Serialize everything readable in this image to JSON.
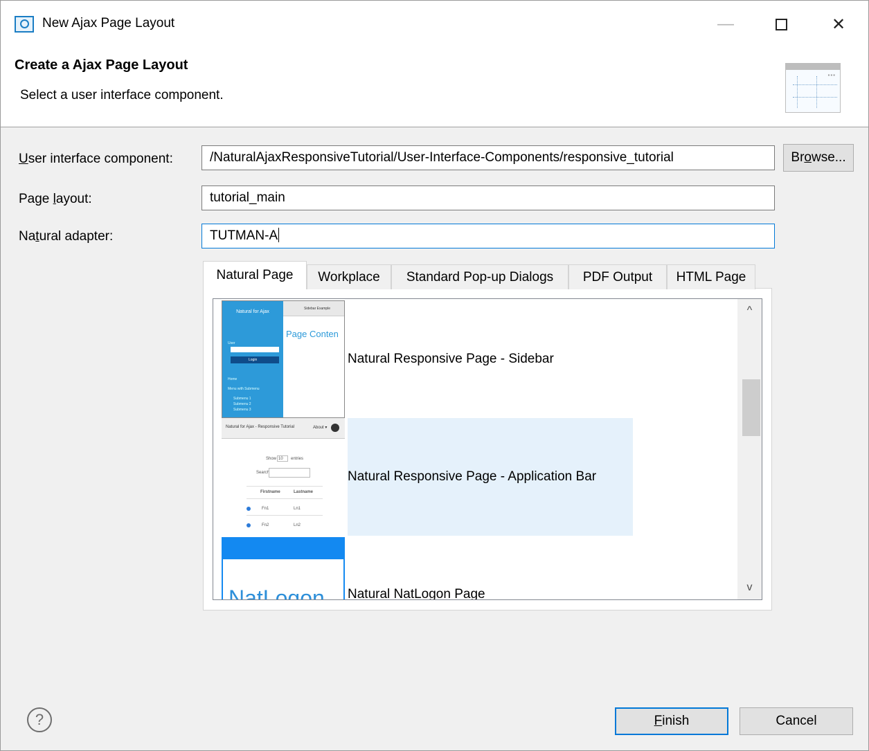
{
  "window": {
    "title": "New Ajax Page Layout",
    "minimize_glyph": "—",
    "close_glyph": "✕"
  },
  "banner": {
    "title": "Create a Ajax Page Layout",
    "description": "Select a user interface component."
  },
  "form": {
    "ui_component": {
      "label_prefix": "",
      "label_mnemonic": "U",
      "label_rest": "ser interface component:",
      "value": "/NaturalAjaxResponsiveTutorial/User-Interface-Components/responsive_tutorial"
    },
    "browse_button": {
      "label_prefix": "Br",
      "label_mnemonic": "o",
      "label_rest": "wse..."
    },
    "page_layout": {
      "label_prefix": "Page ",
      "label_mnemonic": "l",
      "label_rest": "ayout:",
      "value": "tutorial_main"
    },
    "natural_adapter": {
      "label_prefix": "Na",
      "label_mnemonic": "t",
      "label_rest": "ural adapter:",
      "value": "TUTMAN-A"
    }
  },
  "tabs": [
    {
      "label": "Natural Page",
      "active": true
    },
    {
      "label": "Workplace",
      "active": false
    },
    {
      "label": "Standard Pop-up Dialogs",
      "active": false
    },
    {
      "label": "PDF Output",
      "active": false
    },
    {
      "label": "HTML Page",
      "active": false
    }
  ],
  "layouts": [
    {
      "caption": "Natural Responsive Page - Sidebar",
      "selected": false,
      "thumb": {
        "sidebar_title": "Natural for Ajax",
        "header_text": "Sidebar Example",
        "content_text": "Page Conten",
        "user_label": "User",
        "login_label": "Login",
        "menu_items": [
          "Home",
          "Menu with Submenu",
          "Submenu 1",
          "Submenu 2",
          "Submenu 3"
        ]
      }
    },
    {
      "caption": "Natural Responsive Page - Application Bar",
      "selected": true,
      "thumb": {
        "appbar_title": "Natural for Ajax - Responsive Tutorial",
        "about_label": "About ▾",
        "show_label": "Show",
        "show_value": "10",
        "entries_label": "entries",
        "search_label": "Search:",
        "col_firstname": "Firstname",
        "col_lastname": "Lastname",
        "rows": [
          [
            "Fn1",
            "Ln1"
          ],
          [
            "Fn2",
            "Ln2"
          ]
        ]
      }
    },
    {
      "caption": "Natural NatLogon Page",
      "selected": false,
      "thumb": {
        "text": "NatLogon"
      }
    }
  ],
  "scroll": {
    "up_glyph": "^",
    "down_glyph": "v"
  },
  "footer": {
    "help_glyph": "?",
    "finish": {
      "mnemonic": "F",
      "rest": "inish"
    },
    "cancel_label": "Cancel"
  },
  "colors": {
    "accent": "#0078d7",
    "selection": "#e5f1fb",
    "thumb_blue": "#2d9ad9"
  }
}
